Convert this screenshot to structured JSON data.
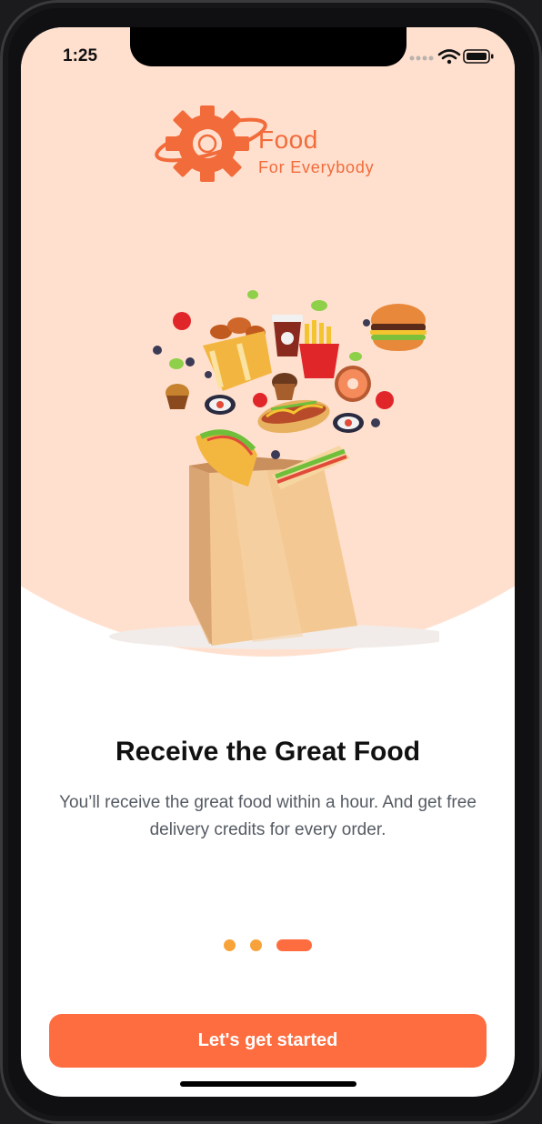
{
  "status_bar": {
    "time": "1:25"
  },
  "logo": {
    "title": "Food",
    "subtitle": "For Everybody"
  },
  "onboarding": {
    "title": "Receive the Great Food",
    "description": "You’ll receive the great food within a hour. And get free delivery credits for every order.",
    "page_indicator": {
      "total": 3,
      "active": 3
    }
  },
  "cta": {
    "label": "Let's get started"
  },
  "colors": {
    "accent": "#fe6d40",
    "hero_bg": "#ffe0cf",
    "dot": "#f7a33a",
    "logo": "#f26b3a"
  }
}
